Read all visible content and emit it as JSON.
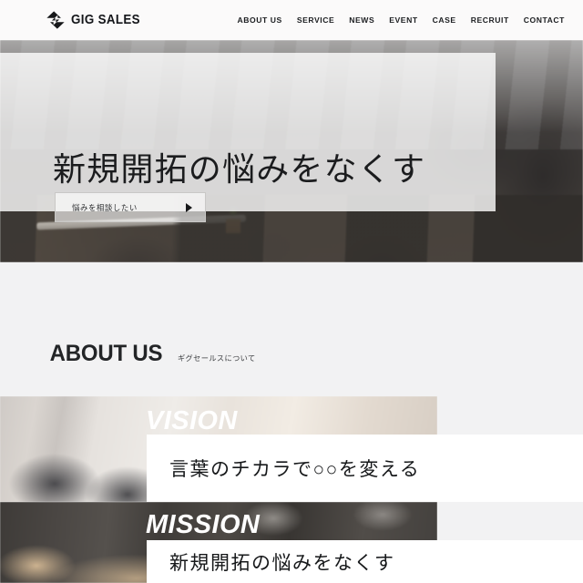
{
  "header": {
    "brand_name": "GIG SALES",
    "brand_icon": "gig-sales-logo-icon",
    "background_color": "#fbfafa",
    "nav": [
      {
        "label": "ABOUT US"
      },
      {
        "label": "SERVICE"
      },
      {
        "label": "NEWS"
      },
      {
        "label": "EVENT"
      },
      {
        "label": "CASE"
      },
      {
        "label": "RECRUIT"
      },
      {
        "label": "CONTACT"
      }
    ]
  },
  "hero": {
    "title": "新規開拓の悩みをなくす",
    "cta_label": "悩みを相談したい",
    "cta_arrow_icon": "play-triangle-icon",
    "overlay_color": "rgba(255,255,255,0.80)",
    "photo_alt": "blurred open-plan office with desks and black chairs"
  },
  "about": {
    "title": "ABOUT US",
    "subtitle": "ギグセールスについて",
    "background_color": "#f2f2f3",
    "blocks": [
      {
        "label": "VISION",
        "text": "言葉のチカラで○○を変える",
        "photo_alt": "bright office interior with mesh chairs"
      },
      {
        "label": "MISSION",
        "text": "新規開拓の悩みをなくす",
        "photo_alt": "dark meeting room with wooden table"
      }
    ]
  },
  "colors": {
    "text_dark": "#16181a",
    "text_body": "#3a3c3f",
    "card_white": "#ffffff",
    "section_gray": "#f2f2f3"
  }
}
